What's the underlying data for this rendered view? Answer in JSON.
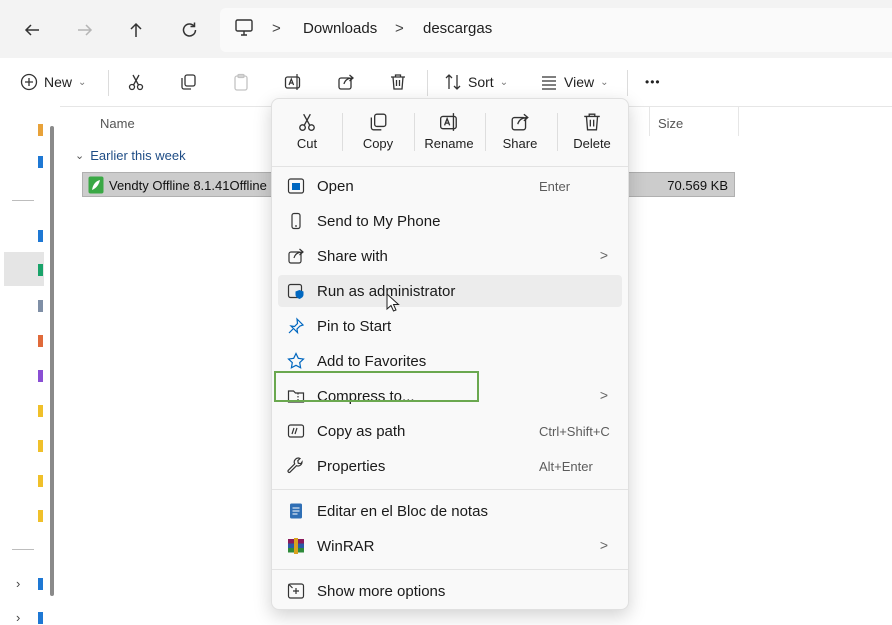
{
  "address_bar": {
    "breadcrumbs": [
      "Downloads",
      "descargas"
    ],
    "separator": ">"
  },
  "command_bar": {
    "new_label": "New",
    "sort_label": "Sort",
    "view_label": "View",
    "more_label": "•••"
  },
  "file_list": {
    "columns": [
      "Name",
      "Size"
    ],
    "group_label": "Earlier this week",
    "files": [
      {
        "name": "Vendty Offline 8.1.41Offline",
        "size": "70.569 KB"
      }
    ]
  },
  "context_menu": {
    "quick_actions": [
      {
        "label": "Cut",
        "icon": "scissors-icon"
      },
      {
        "label": "Copy",
        "icon": "copy-icon"
      },
      {
        "label": "Rename",
        "icon": "rename-icon"
      },
      {
        "label": "Share",
        "icon": "share-icon"
      },
      {
        "label": "Delete",
        "icon": "trash-icon"
      }
    ],
    "items": [
      {
        "label": "Open",
        "shortcut": "Enter",
        "icon": "open-icon"
      },
      {
        "label": "Send to My Phone",
        "icon": "phone-icon"
      },
      {
        "label": "Share with",
        "icon": "share-icon",
        "submenu_glyph": ">"
      },
      {
        "label": "Run as administrator",
        "icon": "shield-icon"
      },
      {
        "label": "Pin to Start",
        "icon": "pin-icon"
      },
      {
        "label": "Add to Favorites",
        "icon": "star-icon"
      },
      {
        "label": "Compress to...",
        "icon": "zip-folder-icon",
        "submenu_glyph": ">"
      },
      {
        "label": "Copy as path",
        "shortcut": "Ctrl+Shift+C",
        "icon": "path-icon"
      },
      {
        "label": "Properties",
        "shortcut": "Alt+Enter",
        "icon": "wrench-icon"
      },
      {
        "label": "Editar en el Bloc de notas",
        "icon": "notepad-icon"
      },
      {
        "label": "WinRAR",
        "icon": "winrar-icon",
        "submenu_glyph": ">"
      },
      {
        "label": "Show more options",
        "icon": "more-options-icon"
      }
    ]
  },
  "colors": {
    "highlight_border": "#6aa84f",
    "selected_row": "#cccccc",
    "accent_blue": "#0067c0"
  }
}
